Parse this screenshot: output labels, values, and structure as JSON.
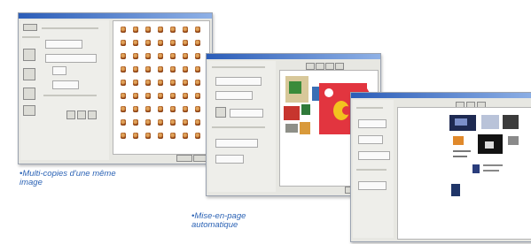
{
  "captions": {
    "multi_copies_line1": "•Multi-copies d'une même",
    "multi_copies_line2": "image",
    "mise_en_page_line1": "•Mise-en-page",
    "mise_en_page_line2": "automatique"
  },
  "colors": {
    "caption": "#2c63b5",
    "title_bar": "#2b5db8",
    "window_bg": "#e7e7e2",
    "red_panel": "#e2353f"
  },
  "grid": {
    "columns": 7,
    "rows": 9,
    "item": "photo-thumbnail"
  }
}
